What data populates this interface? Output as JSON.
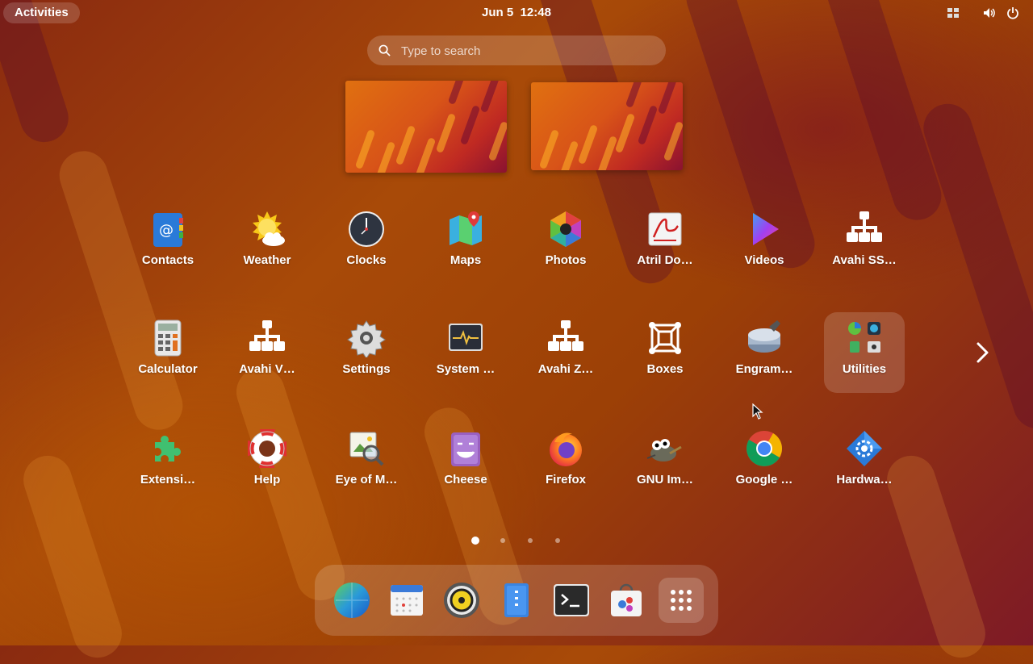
{
  "topbar": {
    "activities_label": "Activities",
    "date": "Jun 5",
    "time": "12:48",
    "tray_icons": [
      "layout-icon",
      "volume-icon",
      "power-icon"
    ]
  },
  "search": {
    "placeholder": "Type to search",
    "value": ""
  },
  "workspaces": {
    "count": 2
  },
  "apps": [
    {
      "label": "Contacts",
      "icon": "contacts-icon"
    },
    {
      "label": "Weather",
      "icon": "weather-icon"
    },
    {
      "label": "Clocks",
      "icon": "clocks-icon"
    },
    {
      "label": "Maps",
      "icon": "maps-icon"
    },
    {
      "label": "Photos",
      "icon": "photos-icon"
    },
    {
      "label": "Atril Do…",
      "icon": "atril-icon"
    },
    {
      "label": "Videos",
      "icon": "videos-icon"
    },
    {
      "label": "Avahi SS…",
      "icon": "network-icon"
    },
    {
      "label": "Calculator",
      "icon": "calculator-icon"
    },
    {
      "label": "Avahi V…",
      "icon": "network-icon"
    },
    {
      "label": "Settings",
      "icon": "gear-icon"
    },
    {
      "label": "System …",
      "icon": "system-monitor-icon"
    },
    {
      "label": "Avahi Z…",
      "icon": "network-icon"
    },
    {
      "label": "Boxes",
      "icon": "boxes-icon"
    },
    {
      "label": "Engram…",
      "icon": "engrampa-icon"
    },
    {
      "label": "Utilities",
      "icon": "utilities-folder-icon",
      "highlighted": true
    },
    {
      "label": "Extensi…",
      "icon": "puzzle-icon"
    },
    {
      "label": "Help",
      "icon": "lifebuoy-icon"
    },
    {
      "label": "Eye of M…",
      "icon": "image-viewer-icon"
    },
    {
      "label": "Cheese",
      "icon": "cheese-icon"
    },
    {
      "label": "Firefox",
      "icon": "firefox-icon"
    },
    {
      "label": "GNU Im…",
      "icon": "gimp-icon"
    },
    {
      "label": "Google …",
      "icon": "chrome-icon"
    },
    {
      "label": "Hardwa…",
      "icon": "hardware-icon"
    }
  ],
  "pagination": {
    "pages": 4,
    "current": 1
  },
  "dock": [
    {
      "name": "web-browser-icon"
    },
    {
      "name": "calendar-icon"
    },
    {
      "name": "music-player-icon"
    },
    {
      "name": "files-icon"
    },
    {
      "name": "terminal-icon"
    },
    {
      "name": "software-store-icon"
    },
    {
      "name": "app-grid-icon",
      "selected": true
    }
  ],
  "colors": {
    "panel": "#ffffff29",
    "accent": "#ffffff"
  }
}
